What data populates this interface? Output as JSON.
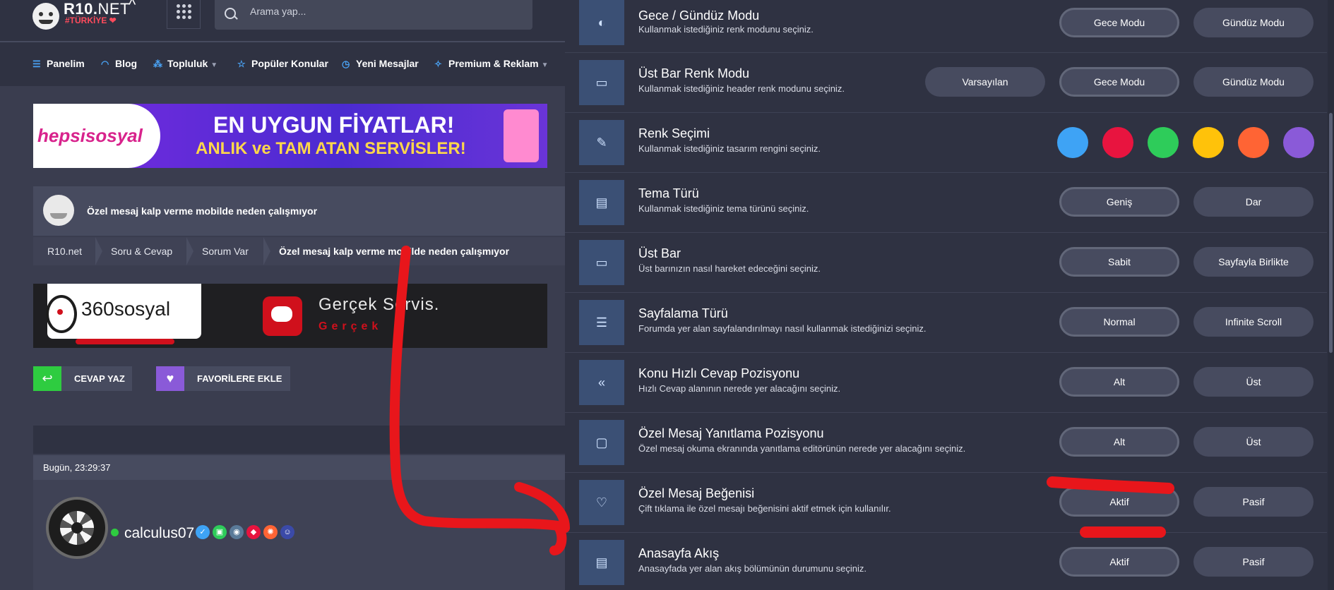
{
  "header": {
    "logo_name": "R10.",
    "logo_net": "NET",
    "logo_tagline": "#TÜRKİYE ❤",
    "logo_caret": "^",
    "search_placeholder": "Arama yap..."
  },
  "nav": {
    "items": [
      {
        "label": "Panelim",
        "icon": "sliders-icon"
      },
      {
        "label": "Blog",
        "icon": "rss-icon"
      },
      {
        "label": "Topluluk",
        "icon": "community-icon",
        "dropdown": true
      },
      {
        "label": "Popüler Konular",
        "icon": "star-icon"
      },
      {
        "label": "Yeni Mesajlar",
        "icon": "clock-icon"
      },
      {
        "label": "Premium & Reklam",
        "icon": "award-icon",
        "dropdown": true
      }
    ]
  },
  "ad_top": {
    "brand": "hepsisosyal",
    "headline": "EN UYGUN FİYATLAR!",
    "subline": "ANLIK ve TAM ATAN SERVİSLER!"
  },
  "thread": {
    "title": "Özel mesaj kalp verme mobilde neden çalışmıyor"
  },
  "breadcrumbs": [
    "R10.net",
    "Soru & Cevap",
    "Sorum Var",
    "Özel mesaj kalp verme mobilde neden çalışmıyor"
  ],
  "ad_mid": {
    "brand": "360sosyal",
    "headline": "Gerçek Servis.",
    "subline": "Gerçek"
  },
  "actions": {
    "reply": "CEVAP YAZ",
    "favorite": "FAVORİLERE EKLE"
  },
  "post": {
    "date": "Bugün, 23:29:37",
    "username": "calculus07"
  },
  "settings": [
    {
      "title": "Gece / Gündüz Modu",
      "desc": "Kullanmak istediğiniz renk modunu seçiniz.",
      "icon": "moon-icon",
      "options": [
        "Gece Modu",
        "Gündüz Modu"
      ],
      "selected": "Gece Modu"
    },
    {
      "title": "Üst Bar Renk Modu",
      "desc": "Kullanmak istediğiniz header renk modunu seçiniz.",
      "icon": "window-icon",
      "options": [
        "Varsayılan",
        "Gece Modu",
        "Gündüz Modu"
      ],
      "selected": "Gece Modu"
    },
    {
      "title": "Renk Seçimi",
      "desc": "Kullanmak istediğiniz tasarım rengini seçiniz.",
      "icon": "palette-icon",
      "swatches": [
        "#3ea3f5",
        "#e8143f",
        "#2ecc5a",
        "#ffc20a",
        "#ff6434",
        "#8a5ad8"
      ]
    },
    {
      "title": "Tema Türü",
      "desc": "Kullanmak istediğiniz tema türünü seçiniz.",
      "icon": "layout-icon",
      "options": [
        "Geniş",
        "Dar"
      ],
      "selected": "Geniş"
    },
    {
      "title": "Üst Bar",
      "desc": "Üst barınızın nasıl hareket edeceğini seçiniz.",
      "icon": "window-icon",
      "options": [
        "Sabit",
        "Sayfayla Birlikte"
      ],
      "selected": "Sabit"
    },
    {
      "title": "Sayfalama Türü",
      "desc": "Forumda yer alan sayfalandırılmayı nasıl kullanmak istediğinizi seçiniz.",
      "icon": "list-icon",
      "options": [
        "Normal",
        "Infinite Scroll"
      ],
      "selected": "Normal"
    },
    {
      "title": "Konu Hızlı Cevap Pozisyonu",
      "desc": "Hızlı Cevap alanının nerede yer alacağını seçiniz.",
      "icon": "reply-all-icon",
      "options": [
        "Alt",
        "Üst"
      ],
      "selected": "Alt"
    },
    {
      "title": "Özel Mesaj Yanıtlama Pozisyonu",
      "desc": "Özel mesaj okuma ekranında yanıtlama editörünün nerede yer alacağını seçiniz.",
      "icon": "message-icon",
      "options": [
        "Alt",
        "Üst"
      ],
      "selected": "Alt"
    },
    {
      "title": "Özel Mesaj Beğenisi",
      "desc": "Çift tıklama ile özel mesajı beğenisini aktif etmek için kullanılır.",
      "icon": "heart-plus-icon",
      "options": [
        "Aktif",
        "Pasif"
      ],
      "selected": "Aktif"
    },
    {
      "title": "Anasayfa Akış",
      "desc": "Anasayfada yer alan akış bölümünün durumunu seçiniz.",
      "icon": "feed-icon",
      "options": [
        "Aktif",
        "Pasif"
      ],
      "selected": "Aktif"
    }
  ],
  "colors": {
    "accent_blue": "#4aa3f5",
    "annotation_red": "#e8161b",
    "reply_green": "#2ecc40",
    "favorite_purple": "#8a5ad8"
  }
}
